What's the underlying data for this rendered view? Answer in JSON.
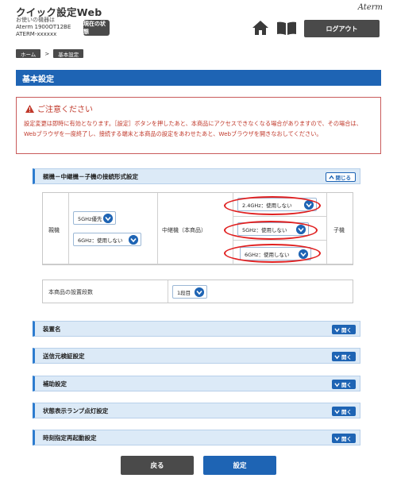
{
  "header": {
    "title": "クイック設定Web",
    "device_caption": "お使いの機器は",
    "device_model": "Aterm 1900OT12BE",
    "device_id": "ATERM-xxxxxx",
    "status_label": "現在の状態",
    "brand": "Aterm",
    "logout_label": "ログアウト",
    "icons": [
      "home-icon",
      "manual-book-icon"
    ]
  },
  "breadcrumb": {
    "items": [
      "ホーム",
      "基本設定"
    ],
    "separator": ">"
  },
  "page_title": "基本設定",
  "notice": {
    "title": "ご注意ください",
    "body": "設定変更は即時に有効となります。［設定］ボタンを押したあと、本商品にアクセスできなくなる場合がありますので、その場合は、Webブラウザを一度終了し、接続する端末と本商品の設定をあわせたあと、Webブラウザを開きなおしてください。"
  },
  "connection_section": {
    "title": "親機－中継機－子機の接続形式設定",
    "toggle_label": "閉じる",
    "parent_label": "親機",
    "parent_selects": [
      "5GHz優先",
      "6GHz：使用しない"
    ],
    "repeater_label": "中継機（本商品）",
    "repeater_selects": [
      "2.4GHz：使用しない",
      "5GHz：使用しない",
      "6GHz：使用しない"
    ],
    "child_label": "子機"
  },
  "install": {
    "label": "本商品の設置段数",
    "value": "1段目"
  },
  "collapsed_sections": [
    {
      "title": "装置名",
      "toggle_label": "開く"
    },
    {
      "title": "送信元検証設定",
      "toggle_label": "開く"
    },
    {
      "title": "補助設定",
      "toggle_label": "開く"
    },
    {
      "title": "状態表示ランプ点灯設定",
      "toggle_label": "開く"
    },
    {
      "title": "時刻指定再起動設定",
      "toggle_label": "開く"
    }
  ],
  "footer": {
    "back_label": "戻る",
    "apply_label": "設定"
  },
  "colors": {
    "accent": "#1e64b4",
    "dark_button": "#4a4a4a",
    "warning": "#c0392b",
    "highlight_ring": "#e02020"
  }
}
